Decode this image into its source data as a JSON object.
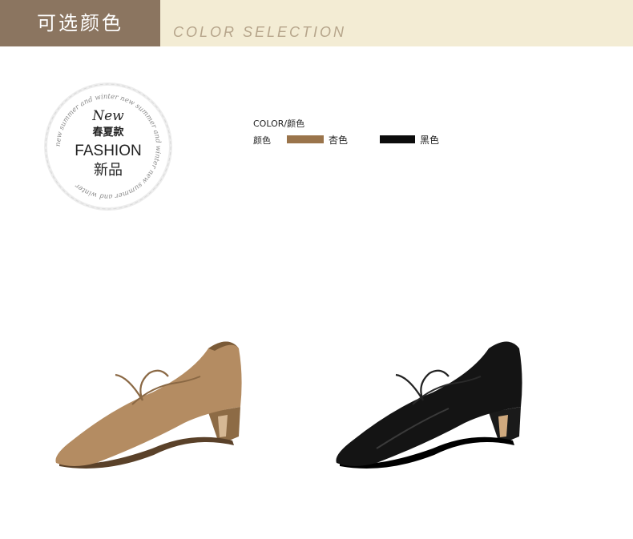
{
  "banner": {
    "title_cn": "可选颜色",
    "title_en": "COLOR SELECTION"
  },
  "badge": {
    "ring_text": "new summer and winter new summer and winter new summer and winter",
    "new_label": "New",
    "season_label": "春夏款",
    "fashion_label": "FASHION",
    "newproduct_label": "新品"
  },
  "legend": {
    "title": "COLOR/颜色",
    "row_label": "颜色",
    "colors": [
      {
        "name": "杏色",
        "hex": "#9a744b"
      },
      {
        "name": "黑色",
        "hex": "#0c0c0c"
      }
    ]
  },
  "products": [
    {
      "color": "杏色",
      "icon": "apricot-lace-up-heel-shoe"
    },
    {
      "color": "黑色",
      "icon": "black-lace-up-heel-shoe"
    }
  ]
}
